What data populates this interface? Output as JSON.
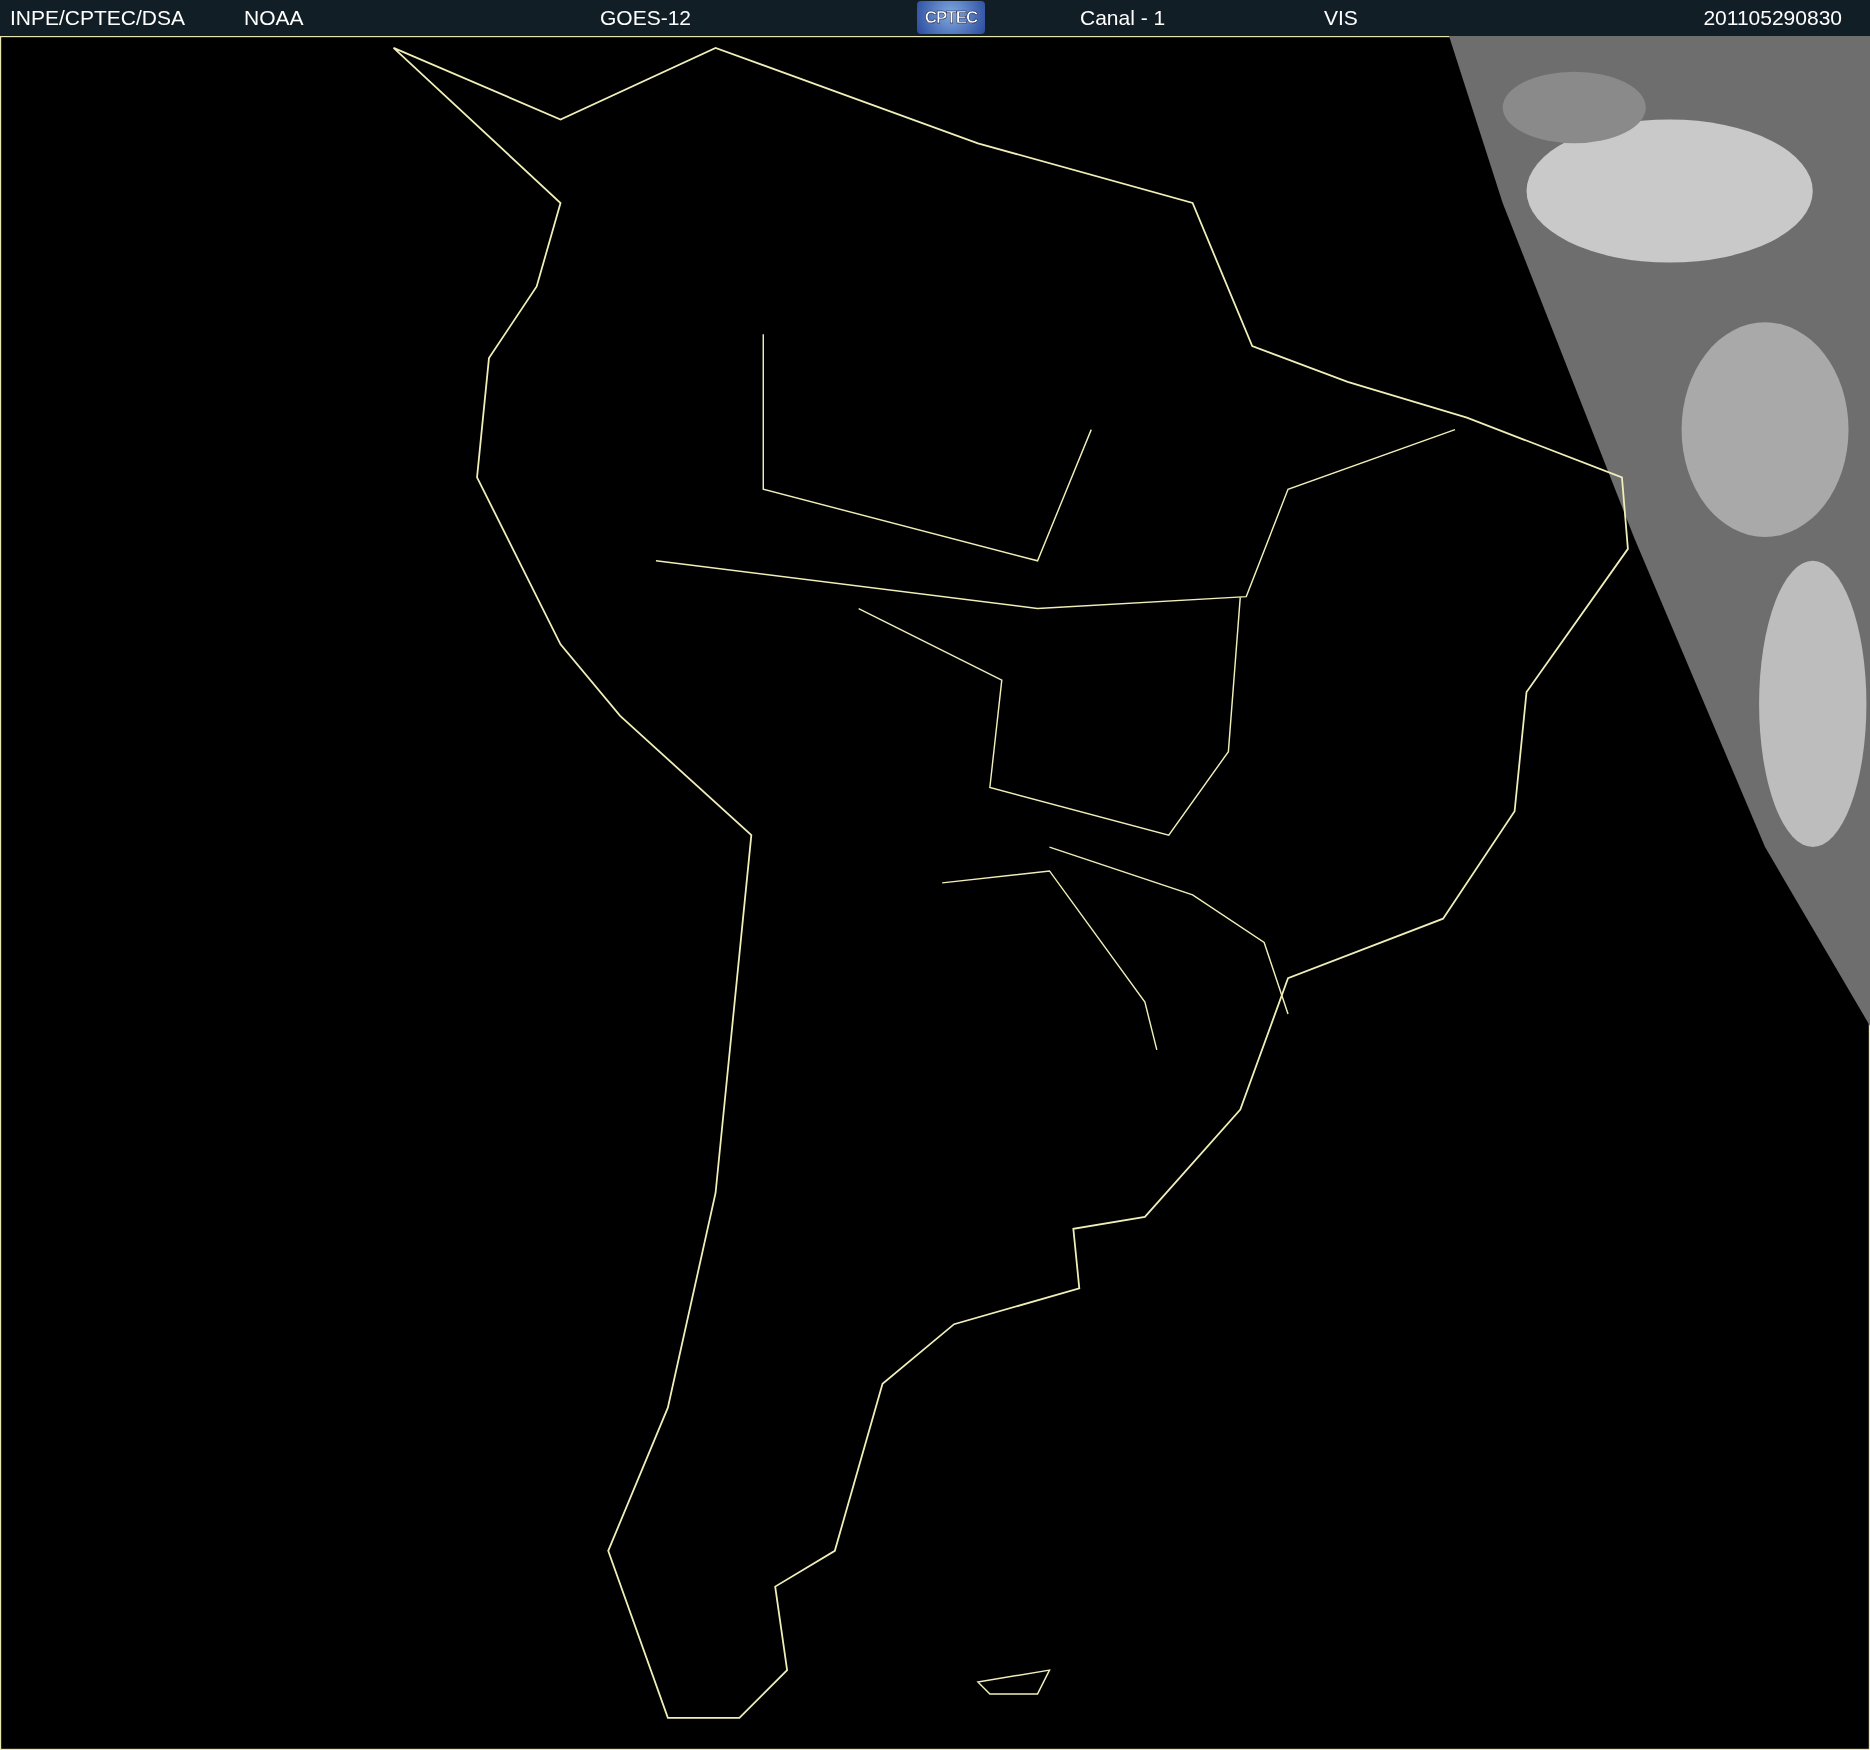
{
  "header": {
    "source": "INPE/CPTEC/DSA",
    "agency": "NOAA",
    "satellite": "GOES-12",
    "logo_text": "CPTEC",
    "channel": "Canal - 1",
    "band": "VIS",
    "timestamp": "201105290830"
  }
}
